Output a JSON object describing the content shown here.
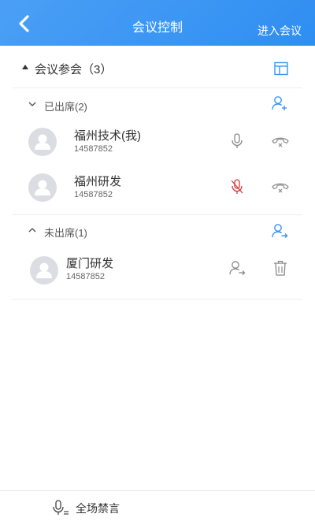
{
  "header": {
    "title": "会议控制",
    "enter_label": "进入会议",
    "back_icon": "chevron-left-icon"
  },
  "summary": {
    "label": "会议参会（3）",
    "layout_icon": "layout-icon"
  },
  "groups": [
    {
      "label": "已出席(2)",
      "expanded": true,
      "action_icon": "add-user-icon",
      "members": [
        {
          "name": "福州技术(我)",
          "id": "14587852",
          "mic_icon": "microphone-icon",
          "mic_muted": false,
          "action_icon": "hang-up-icon"
        },
        {
          "name": "福州研发",
          "id": "14587852",
          "mic_icon": "microphone-muted-icon",
          "mic_muted": true,
          "action_icon": "hang-up-icon"
        }
      ]
    },
    {
      "label": "未出席(1)",
      "expanded": true,
      "action_icon": "invite-user-icon",
      "members": [
        {
          "name": "厦门研发",
          "id": "14587852",
          "invite_icon": "invite-user-icon",
          "action_icon": "trash-icon"
        }
      ]
    }
  ],
  "footer": {
    "mute_all_label": "全场禁言",
    "icon": "microphone-mute-all-icon"
  },
  "colors": {
    "header_blue": "#3a94f3",
    "accent_blue": "#2f8ef2",
    "muted_red": "#d23b3b",
    "icon_gray": "#888888"
  }
}
